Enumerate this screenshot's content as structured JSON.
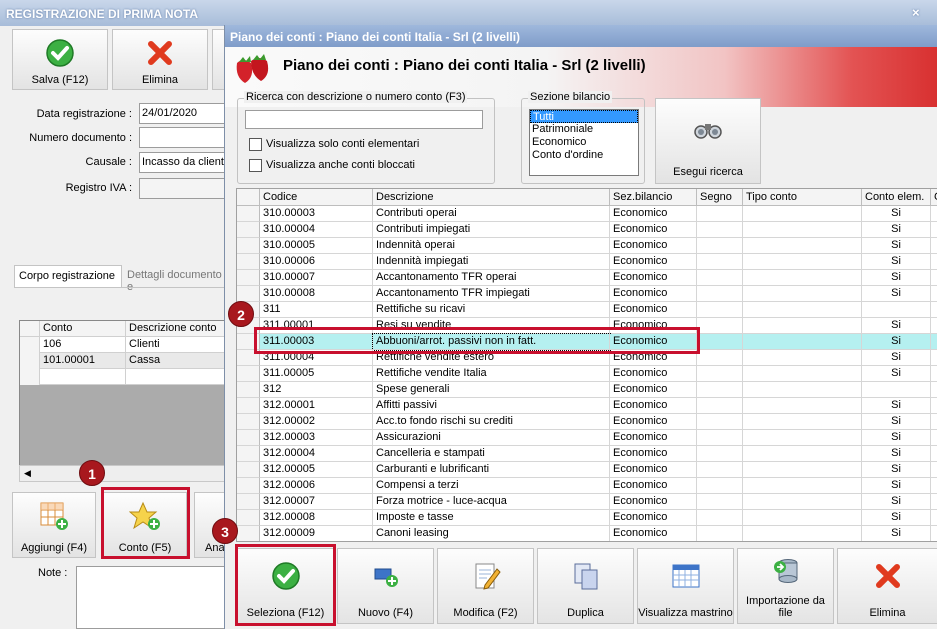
{
  "back_window": {
    "title": "REGISTRAZIONE DI PRIMA NOTA",
    "close": "×",
    "toolbar": {
      "save": "Salva (F12)",
      "delete": "Elimina"
    },
    "fields": {
      "data_label": "Data registrazione :",
      "data_value": "24/01/2020",
      "numdoc_label": "Numero documento :",
      "numdoc_value": "",
      "causale_label": "Causale :",
      "causale_value": "Incasso da cliente",
      "registro_label": "Registro IVA :",
      "registro_value": ""
    },
    "tabs": [
      "Corpo registrazione",
      "Dettagli documento e"
    ],
    "grid": {
      "headers": [
        "Conto",
        "Descrizione conto"
      ],
      "rows": [
        [
          "106",
          "Clienti"
        ],
        [
          "101.00001",
          "Cassa"
        ]
      ]
    },
    "bottom_buttons": {
      "add": "Aggiungi (F4)",
      "account": "Conto (F5)",
      "partial": "Ana"
    },
    "notes_label": "Note :"
  },
  "dialog": {
    "title": "Piano dei conti : Piano dei conti Italia - Srl (2 livelli)",
    "banner_title": "Piano dei conti : Piano dei conti Italia - Srl (2 livelli)",
    "search": {
      "group_label": "Ricerca con descrizione o numero conto (F3)",
      "value": "",
      "chk_elementari": "Visualizza solo conti elementari",
      "chk_bloccati": "Visualizza anche conti bloccati"
    },
    "sezione": {
      "label": "Sezione bilancio",
      "options": [
        "Tutti",
        "Patrimoniale",
        "Economico",
        "Conto d'ordine"
      ],
      "selected": "Tutti"
    },
    "search_button": "Esegui ricerca",
    "table": {
      "headers": [
        "Codice",
        "Descrizione",
        "Sez.bilancio",
        "Segno",
        "Tipo conto",
        "Conto elem.",
        "C"
      ],
      "rows": [
        [
          "310.00003",
          "Contributi operai",
          "Economico",
          "",
          "",
          "Si"
        ],
        [
          "310.00004",
          "Contributi impiegati",
          "Economico",
          "",
          "",
          "Si"
        ],
        [
          "310.00005",
          "Indennità operai",
          "Economico",
          "",
          "",
          "Si"
        ],
        [
          "310.00006",
          "Indennità impiegati",
          "Economico",
          "",
          "",
          "Si"
        ],
        [
          "310.00007",
          "Accantonamento TFR operai",
          "Economico",
          "",
          "",
          "Si"
        ],
        [
          "310.00008",
          "Accantonamento TFR impiegati",
          "Economico",
          "",
          "",
          "Si"
        ],
        [
          "311",
          "Rettifiche su ricavi",
          "Economico",
          "",
          "",
          ""
        ],
        [
          "311.00001",
          "Resi su vendite",
          "Economico",
          "",
          "",
          "Si"
        ],
        [
          "311.00003",
          "Abbuoni/arrot. passivi non in fatt.",
          "Economico",
          "",
          "",
          "Si"
        ],
        [
          "311.00004",
          "Rettifiche vendite estero",
          "Economico",
          "",
          "",
          "Si"
        ],
        [
          "311.00005",
          "Rettifiche vendite Italia",
          "Economico",
          "",
          "",
          "Si"
        ],
        [
          "312",
          "Spese generali",
          "Economico",
          "",
          "",
          ""
        ],
        [
          "312.00001",
          "Affitti passivi",
          "Economico",
          "",
          "",
          "Si"
        ],
        [
          "312.00002",
          "Acc.to fondo rischi su crediti",
          "Economico",
          "",
          "",
          "Si"
        ],
        [
          "312.00003",
          "Assicurazioni",
          "Economico",
          "",
          "",
          "Si"
        ],
        [
          "312.00004",
          "Cancelleria e stampati",
          "Economico",
          "",
          "",
          "Si"
        ],
        [
          "312.00005",
          "Carburanti e lubrificanti",
          "Economico",
          "",
          "",
          "Si"
        ],
        [
          "312.00006",
          "Compensi a terzi",
          "Economico",
          "",
          "",
          "Si"
        ],
        [
          "312.00007",
          "Forza motrice - luce-acqua",
          "Economico",
          "",
          "",
          "Si"
        ],
        [
          "312.00008",
          "Imposte e tasse",
          "Economico",
          "",
          "",
          "Si"
        ],
        [
          "312.00009",
          "Canoni leasing",
          "Economico",
          "",
          "",
          "Si"
        ]
      ]
    },
    "buttons": {
      "select": "Seleziona (F12)",
      "new": "Nuovo (F4)",
      "edit": "Modifica (F2)",
      "duplicate": "Duplica",
      "ledger": "Visualizza mastrino",
      "import": "Importazione da file",
      "delete": "Elimina"
    }
  },
  "annotations": {
    "step1": "1",
    "step2": "2",
    "step3": "3"
  },
  "colors": {
    "highlight_row": "#b5f0f0",
    "annotation_red": "#c8102e",
    "selection_blue": "#3399ff"
  }
}
